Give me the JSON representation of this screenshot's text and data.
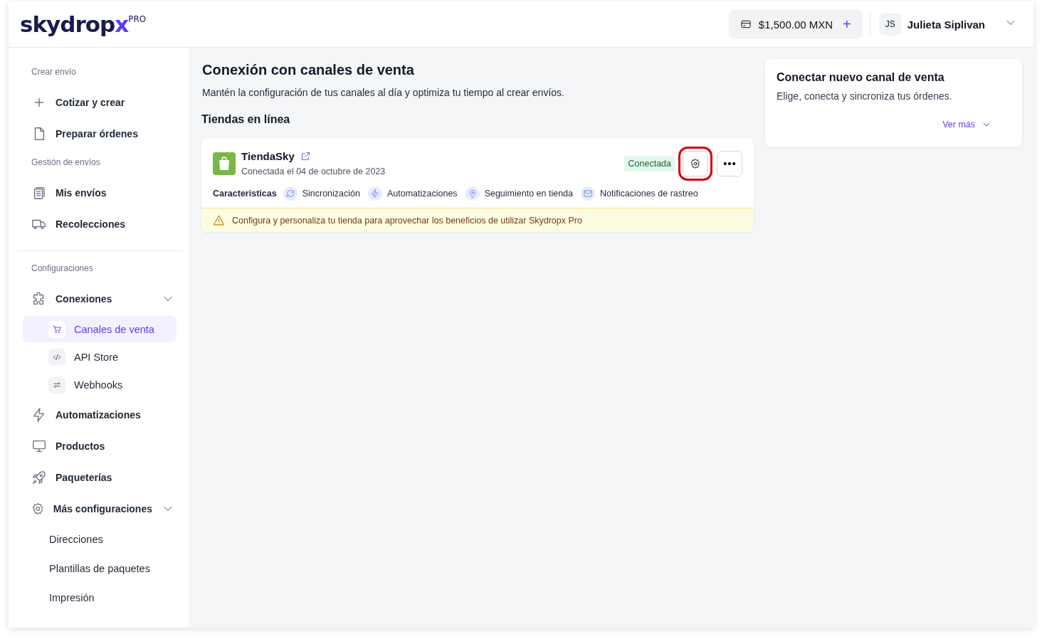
{
  "header": {
    "logo": {
      "text": "skydrop",
      "accent": "x",
      "badge": "PRO"
    },
    "balance": {
      "amount": "$1,500.00 MXN",
      "add": "+"
    },
    "user": {
      "initials": "JS",
      "name": "Julieta Siplivan"
    }
  },
  "sidebar": {
    "sections": [
      {
        "label": "Crear envío",
        "items": [
          {
            "label": "Cotizar y crear",
            "selected": false
          },
          {
            "label": "Preparar órdenes",
            "selected": false
          }
        ]
      },
      {
        "label": "Gestión de envíos",
        "items": [
          {
            "label": "Mis envíos",
            "selected": false
          },
          {
            "label": "Recolecciones",
            "selected": false
          }
        ]
      },
      {
        "label": "Configuraciones",
        "items": [
          {
            "label": "Conexiones",
            "selected": false,
            "expanded": true,
            "children": [
              {
                "label": "Canales de venta",
                "selected": true
              },
              {
                "label": "API Store",
                "selected": false
              },
              {
                "label": "Webhooks",
                "selected": false
              }
            ]
          },
          {
            "label": "Automatizaciones",
            "selected": false
          },
          {
            "label": "Productos",
            "selected": false
          },
          {
            "label": "Paqueterías",
            "selected": false
          },
          {
            "label": "Más configuraciones",
            "selected": false,
            "expanded": true,
            "children": [
              {
                "label": "Direcciones",
                "selected": false
              },
              {
                "label": "Plantillas de paquetes",
                "selected": false
              },
              {
                "label": "Impresión",
                "selected": false
              }
            ]
          }
        ]
      }
    ]
  },
  "main": {
    "title": "Conexión con canales de venta",
    "subtitle": "Mantén la configuración de tus canales al día y optimiza tu tiempo al crear envíos.",
    "section_title": "Tiendas en línea",
    "stores": [
      {
        "name": "TiendaSky",
        "connected_on": "Conectada el 04 de octubre de 2023",
        "status": "Conectada",
        "settings_highlighted": true,
        "features_label": "Caracteristicas",
        "features": [
          {
            "label": "Sincronización"
          },
          {
            "label": "Automatizaciones"
          },
          {
            "label": "Seguimiento en tienda"
          },
          {
            "label": "Notificaciones de rastreo"
          }
        ],
        "warning": "Configura y personaliza tu tienda para aprovechar los beneficios de utilizar Skydropx Pro"
      }
    ]
  },
  "side_card": {
    "title": "Conectar nuevo canal de venta",
    "text": "Elige, conecta y sincroniza tus órdenes.",
    "link": "Ver más"
  }
}
